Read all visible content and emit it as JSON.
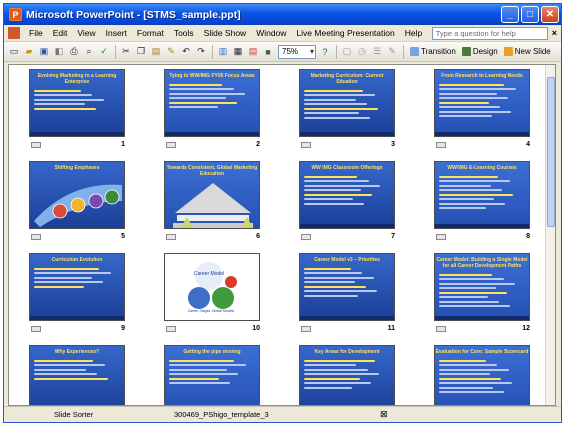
{
  "window": {
    "title": "Microsoft PowerPoint - [STMS_sample.ppt]"
  },
  "menu": {
    "items": [
      "File",
      "Edit",
      "View",
      "Insert",
      "Format",
      "Tools",
      "Slide Show",
      "Window",
      "Live Meeting Presentation",
      "Help"
    ],
    "help_placeholder": "Type a question for help"
  },
  "toolbar": {
    "zoom": "75%",
    "transition": "Transition",
    "design": "Design",
    "new_slide": "New Slide"
  },
  "slides": [
    {
      "num": "1",
      "title": "Evolving Marketing to a Learning Enterprise"
    },
    {
      "num": "2",
      "title": "Tying to WW/IMG FY05 Focus Areas"
    },
    {
      "num": "3",
      "title": "Marketing Curriculum: Current Situation"
    },
    {
      "num": "4",
      "title": "From Research to Learning Needs"
    },
    {
      "num": "5",
      "title": "Shifting Emphases"
    },
    {
      "num": "6",
      "title": "Towards Consistent, Global Marketing Education"
    },
    {
      "num": "7",
      "title": "WW IMG Classroom Offerings"
    },
    {
      "num": "8",
      "title": "WW/IMG E-Learning Courses"
    },
    {
      "num": "9",
      "title": "Curriculum Evolution"
    },
    {
      "num": "10",
      "title": "Career Model"
    },
    {
      "num": "11",
      "title": "Career Model v3 – Priorities"
    },
    {
      "num": "12",
      "title": "Career Model: Building a Single Model for all Career Development Paths"
    },
    {
      "num": "13",
      "title": "Why Experiences?"
    },
    {
      "num": "14",
      "title": "Getting the pipe moving"
    },
    {
      "num": "15",
      "title": "Key Areas for Development"
    },
    {
      "num": "16",
      "title": "Evaluation for Core: Sample Scorecard"
    }
  ],
  "slide10": {
    "center": "Career Model",
    "left": "Career Stages",
    "right": "Global Models"
  },
  "status": {
    "view": "Slide Sorter",
    "template": "300469_PShigo_template_3"
  },
  "colors": {
    "titlebar": "#0a54e3",
    "slide_bg": "#2a52b5",
    "slide_title": "#ffe25a"
  }
}
